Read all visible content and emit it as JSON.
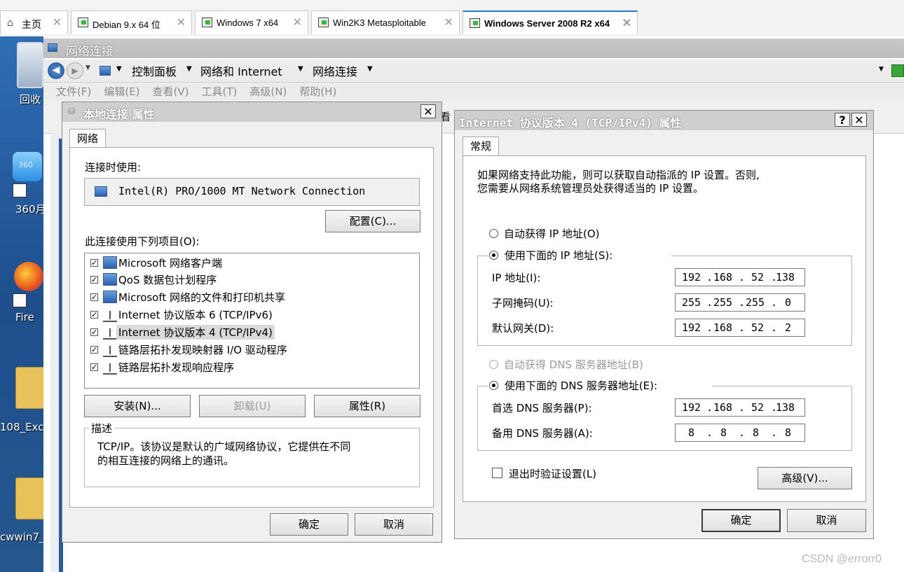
{
  "vmware_tabs": {
    "home": "主页",
    "items": [
      "Debian 9.x 64 位",
      "Windows 7 x64",
      "Win2K3 Metasploitable",
      "Windows Server 2008 R2 x64"
    ]
  },
  "desktop": {
    "labels": [
      "回收",
      "360",
      "360月",
      "Fire",
      "108_Exc",
      "cwwin7_"
    ]
  },
  "explorer": {
    "title": "网络连接",
    "breadcrumb": [
      "控制面板",
      "网络和 Internet",
      "网络连接"
    ],
    "menu": [
      "文件(F)",
      "编辑(E)",
      "查看(V)",
      "工具(T)",
      "高级(N)",
      "帮助(H)"
    ],
    "partial_text": "看"
  },
  "local_props": {
    "title": "本地连接 属性",
    "tab": "网络",
    "connect_using_label": "连接时使用:",
    "adapter": "Intel(R) PRO/1000 MT Network Connection",
    "configure_button": "配置(C)...",
    "items_label": "此连接使用下列项目(O):",
    "items": [
      {
        "label": "Microsoft 网络客户端",
        "checked": true,
        "icon": "network-client-icon"
      },
      {
        "label": "QoS 数据包计划程序",
        "checked": true,
        "icon": "network-service-icon"
      },
      {
        "label": "Microsoft 网络的文件和打印机共享",
        "checked": true,
        "icon": "network-service-icon"
      },
      {
        "label": "Internet 协议版本 6 (TCP/IPv6)",
        "checked": true,
        "icon": "protocol-icon"
      },
      {
        "label": "Internet 协议版本 4 (TCP/IPv4)",
        "checked": true,
        "icon": "protocol-icon",
        "selected": true
      },
      {
        "label": "链路层拓扑发现映射器 I/O 驱动程序",
        "checked": true,
        "icon": "protocol-icon"
      },
      {
        "label": "链路层拓扑发现响应程序",
        "checked": true,
        "icon": "protocol-icon"
      }
    ],
    "install_button": "安装(N)...",
    "uninstall_button": "卸载(U)",
    "properties_button": "属性(R)",
    "description_title": "描述",
    "description_text_1": "TCP/IP。该协议是默认的广域网络协议，它提供在不同",
    "description_text_2": "的相互连接的网络上的通讯。",
    "ok_button": "确定",
    "cancel_button": "取消"
  },
  "ipv4_props": {
    "title": "Internet 协议版本 4 (TCP/IPv4) 属性",
    "help_button": "?",
    "tab": "常规",
    "intro_1": "如果网络支持此功能，则可以获取自动指派的 IP 设置。否则,",
    "intro_2": "您需要从网络系统管理员处获得适当的 IP 设置。",
    "auto_ip": "自动获得 IP 地址(O)",
    "manual_ip": "使用下面的 IP 地址(S):",
    "ip_label": "IP 地址(I):",
    "ip_value": [
      "192",
      "168",
      "52",
      "138"
    ],
    "mask_label": "子网掩码(U):",
    "mask_value": [
      "255",
      "255",
      "255",
      "0"
    ],
    "gateway_label": "默认网关(D):",
    "gateway_value": [
      "192",
      "168",
      "52",
      "2"
    ],
    "auto_dns": "自动获得 DNS 服务器地址(B)",
    "manual_dns": "使用下面的 DNS 服务器地址(E):",
    "dns1_label": "首选 DNS 服务器(P):",
    "dns1_value": [
      "192",
      "168",
      "52",
      "138"
    ],
    "dns2_label": "备用 DNS 服务器(A):",
    "dns2_value": [
      "8",
      "8",
      "8",
      "8"
    ],
    "validate_label": "退出时验证设置(L)",
    "advanced_button": "高级(V)...",
    "ok_button": "确定",
    "cancel_button": "取消"
  },
  "watermark": "CSDN @errorr0"
}
